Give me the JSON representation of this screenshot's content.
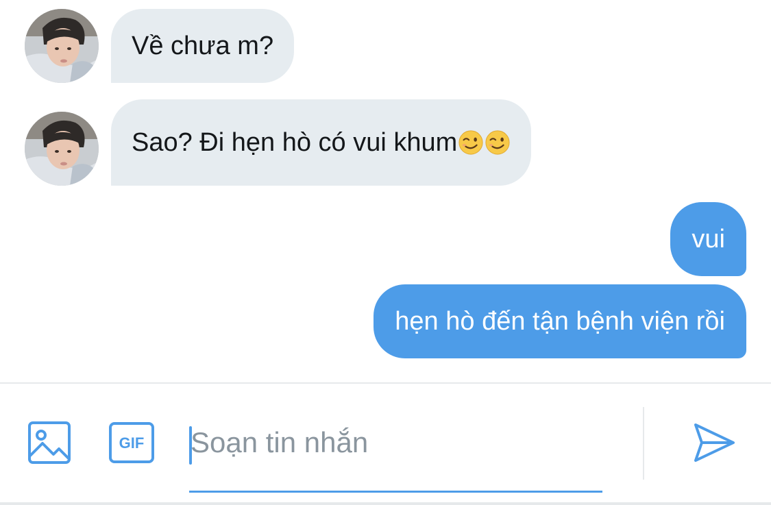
{
  "conversation": {
    "messages": [
      {
        "side": "incoming",
        "text": "Về chưa m?"
      },
      {
        "side": "incoming",
        "text": "Sao? Đi hẹn hò có vui khum",
        "emoji": [
          "winking-face",
          "winking-face"
        ]
      },
      {
        "side": "outgoing",
        "text": "vui"
      },
      {
        "side": "outgoing",
        "text": "hẹn hò đến tận bệnh viện rồi"
      }
    ]
  },
  "composer": {
    "placeholder": "Soạn tin nhắn",
    "gif_label": "GIF",
    "icons": [
      "image-icon",
      "gif-icon",
      "send-icon"
    ]
  },
  "colors": {
    "accent": "#4d9ce8",
    "incoming_bubble": "#e6ecf0",
    "incoming_text": "#14171a",
    "outgoing_text": "#ffffff",
    "placeholder": "#8a959e"
  }
}
